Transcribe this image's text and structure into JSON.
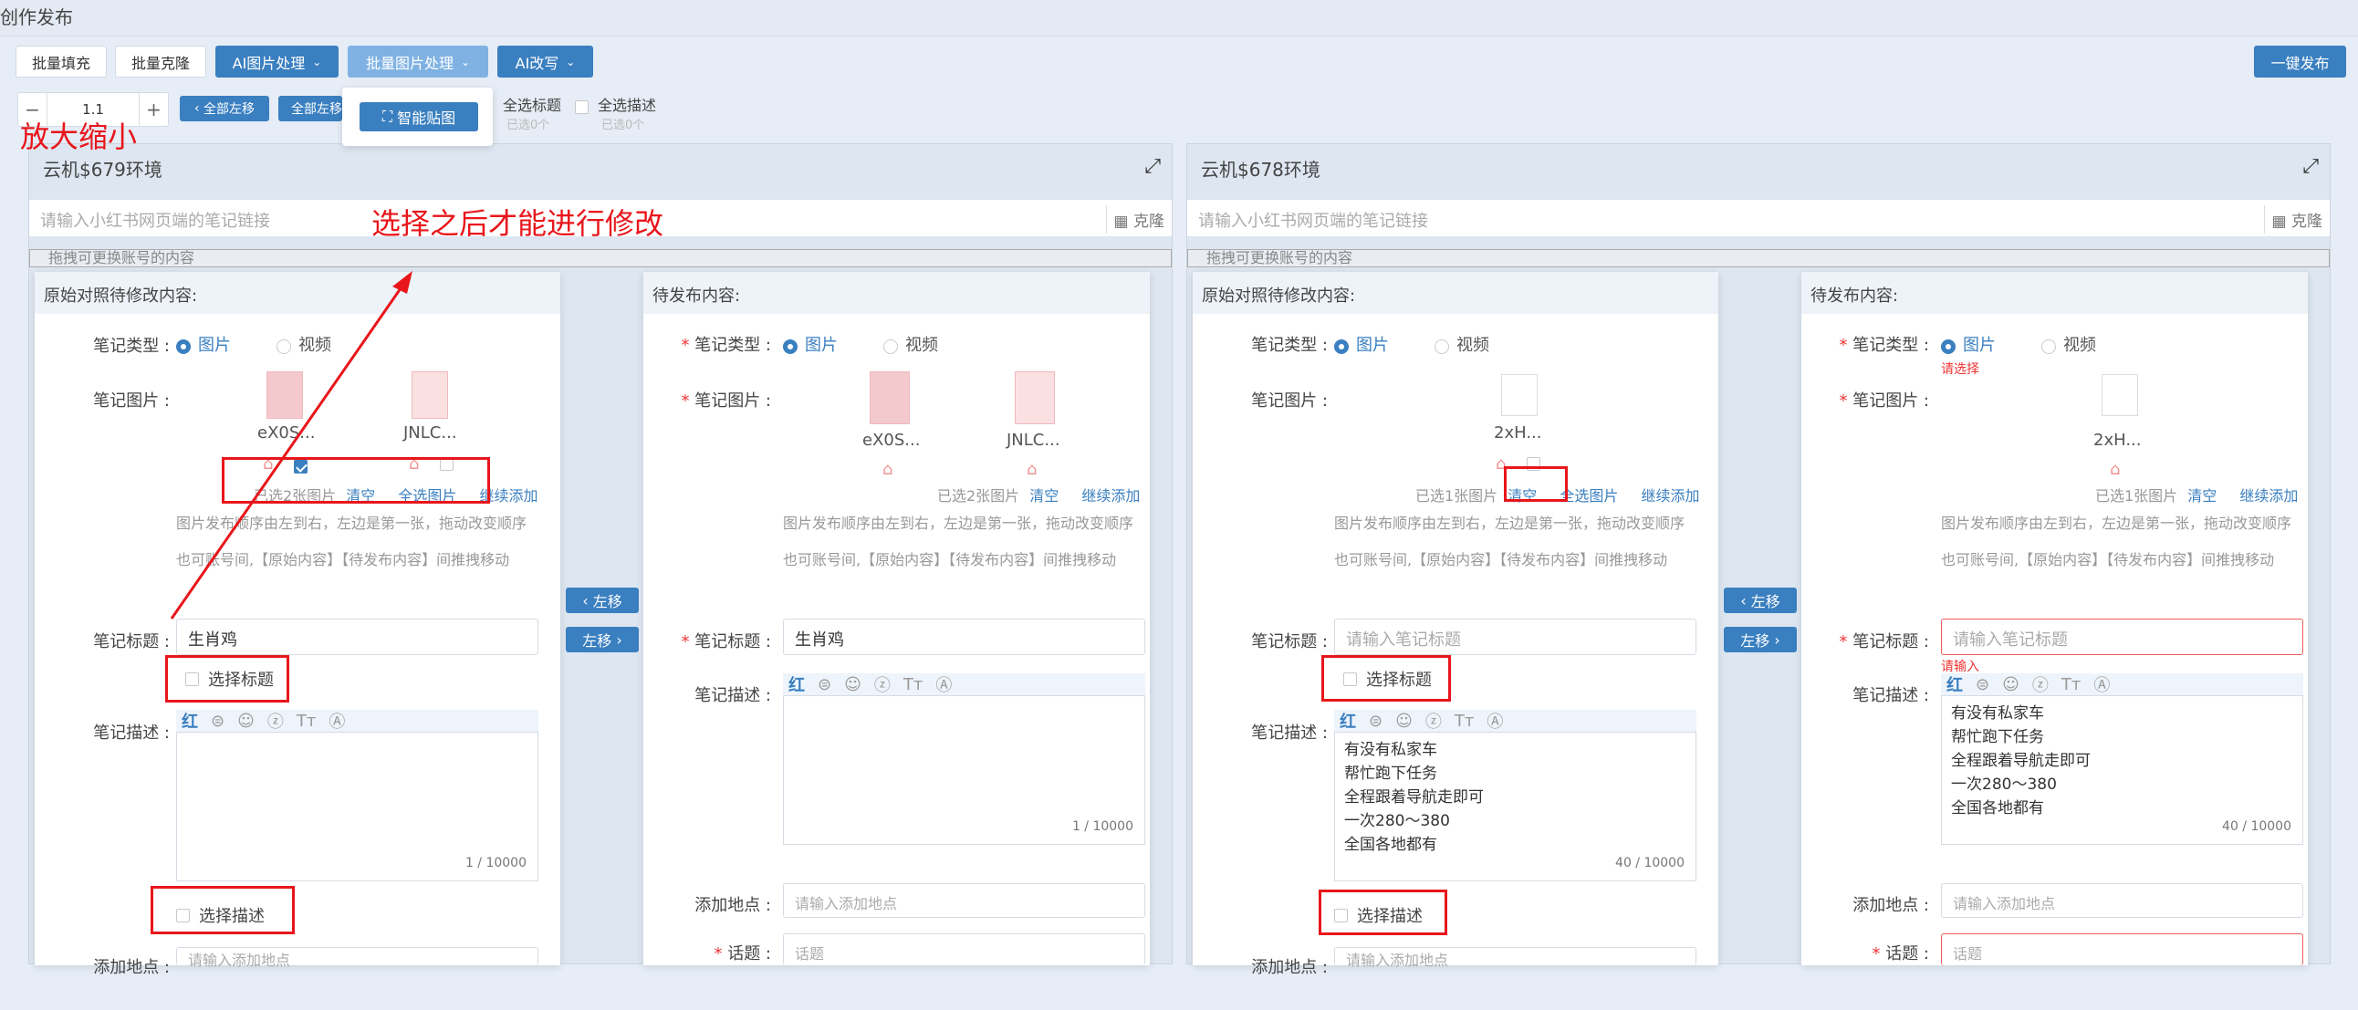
{
  "header": {
    "title": "创作发布"
  },
  "toolbar": {
    "batch_fill": "批量填充",
    "batch_clone": "批量克隆",
    "ai_image": "AI图片处理",
    "batch_image": "批量图片处理",
    "ai_rewrite": "AI改写",
    "publish_all": "一键发布"
  },
  "dropdown": {
    "smart_paste": "智能贴图"
  },
  "zoom": {
    "value": "1.1",
    "minus": "−",
    "plus": "+"
  },
  "move": {
    "all_left": "全部左移",
    "all_left2": "全部左移"
  },
  "select_all": {
    "title_label": "全选标题",
    "title_count": "已选0个",
    "desc_label": "全选描述",
    "desc_count": "已选0个"
  },
  "annotations": {
    "zoom_note": "放大缩小",
    "select_note": "选择之后才能进行修改"
  },
  "env_left": {
    "title": "云机$679环境",
    "link_placeholder": "请输入小红书网页端的笔记链接",
    "clone": "克隆",
    "drag_hint": "拖拽可更换账号的内容",
    "original": {
      "header": "原始对照待修改内容:",
      "type_label": "笔记类型 :",
      "type_image": "图片",
      "type_video": "视频",
      "images_label": "笔记图片 :",
      "img1": "eX0S...",
      "img2": "JNLC...",
      "selected": "已选2张图片",
      "clear": "清空",
      "select_all": "全选图片",
      "continue": "继续添加",
      "hint1": "图片发布顺序由左到右，左边是第一张，拖动改变顺序",
      "hint2": "也可账号间,【原始内容】【待发布内容】间推拽移动",
      "title_label": "笔记标题 :",
      "title_value": "生肖鸡",
      "select_title": "选择标题",
      "desc_label": "笔记描述 :",
      "desc_count": "1 / 10000",
      "select_desc": "选择描述",
      "loc_label": "添加地点 :",
      "loc_placeholder": "请输入添加地点"
    },
    "publish": {
      "header": "待发布内容:",
      "type_label": "笔记类型 :",
      "type_image": "图片",
      "type_video": "视频",
      "images_label": "笔记图片 :",
      "img1": "eX0S...",
      "img2": "JNLC...",
      "selected": "已选2张图片",
      "clear": "清空",
      "continue": "继续添加",
      "hint1": "图片发布顺序由左到右，左边是第一张，拖动改变顺序",
      "hint2": "也可账号间,【原始内容】【待发布内容】间推拽移动",
      "title_label": "笔记标题 :",
      "title_value": "生肖鸡",
      "desc_label": "笔记描述 :",
      "desc_count": "1 / 10000",
      "loc_label": "添加地点 :",
      "loc_placeholder": "请输入添加地点",
      "topic_label": "话题 :",
      "topic_placeholder": "话题"
    },
    "btn_left": "左移",
    "btn_right": "左移"
  },
  "env_right": {
    "title": "云机$678环境",
    "link_placeholder": "请输入小红书网页端的笔记链接",
    "clone": "克隆",
    "drag_hint": "拖拽可更换账号的内容",
    "original": {
      "header": "原始对照待修改内容:",
      "type_label": "笔记类型 :",
      "type_image": "图片",
      "type_video": "视频",
      "images_label": "笔记图片 :",
      "img1": "2xH...",
      "selected": "已选1张图片",
      "clear": "清空",
      "select_all": "全选图片",
      "continue": "继续添加",
      "hint1": "图片发布顺序由左到右，左边是第一张，拖动改变顺序",
      "hint2": "也可账号间,【原始内容】【待发布内容】间推拽移动",
      "title_label": "笔记标题 :",
      "title_placeholder": "请输入笔记标题",
      "select_title": "选择标题",
      "desc_label": "笔记描述 :",
      "desc_lines": [
        "有没有私家车",
        "帮忙跑下任务",
        "全程跟着导航走即可",
        "一次280～380",
        "全国各地都有"
      ],
      "desc_count": "40 / 10000",
      "select_desc": "选择描述",
      "loc_label": "添加地点 :",
      "loc_placeholder": "请输入添加地点"
    },
    "publish": {
      "header": "待发布内容:",
      "type_label": "笔记类型 :",
      "type_image": "图片",
      "type_video": "视频",
      "type_error": "请选择",
      "images_label": "笔记图片 :",
      "img1": "2xH...",
      "selected": "已选1张图片",
      "clear": "清空",
      "continue": "继续添加",
      "hint1": "图片发布顺序由左到右，左边是第一张，拖动改变顺序",
      "hint2": "也可账号间,【原始内容】【待发布内容】间推拽移动",
      "title_label": "笔记标题 :",
      "title_placeholder": "请输入笔记标题",
      "title_error": "请输入",
      "desc_label": "笔记描述 :",
      "desc_lines": [
        "有没有私家车",
        "帮忙跑下任务",
        "全程跟着导航走即可",
        "一次280～380",
        "全国各地都有"
      ],
      "desc_count": "40 / 10000",
      "loc_label": "添加地点 :",
      "loc_placeholder": "请输入添加地点",
      "topic_label": "话题 :",
      "topic_placeholder": "话题"
    },
    "btn_left": "左移",
    "btn_right": "左移"
  }
}
